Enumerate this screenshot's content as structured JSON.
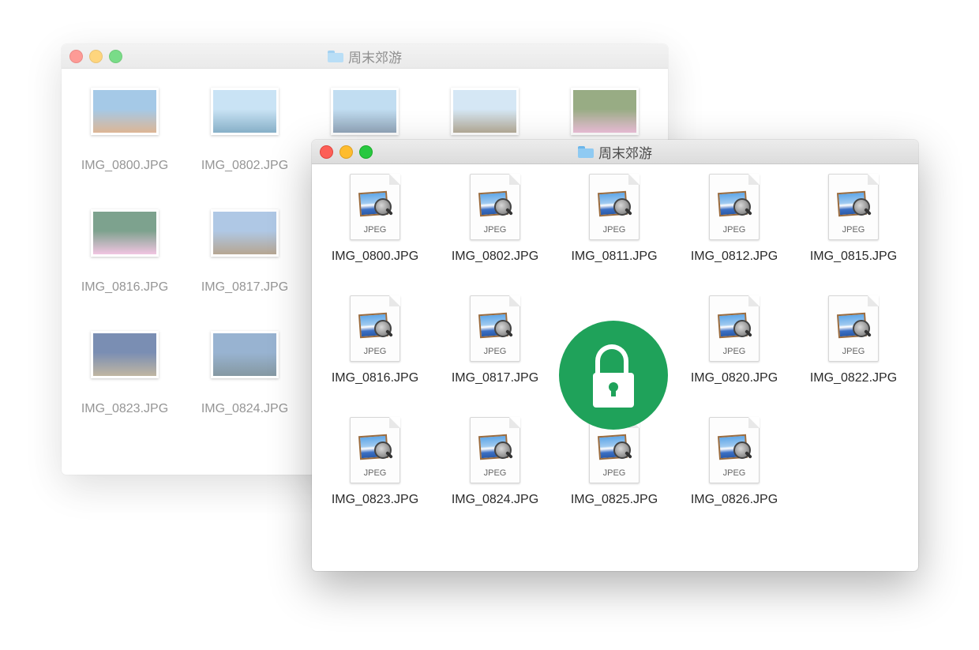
{
  "back_window": {
    "title": "周末郊游",
    "files": [
      {
        "name": "IMG_0800.JPG",
        "colors": [
          "#6fa9d9",
          "#c98a55"
        ]
      },
      {
        "name": "IMG_0802.JPG",
        "colors": [
          "#a9d3ef",
          "#3e7fa6"
        ]
      },
      {
        "name": "IMG_0811.JPG",
        "colors": [
          "#9cc9e9",
          "#4f6f8f"
        ]
      },
      {
        "name": "IMG_0812.JPG",
        "colors": [
          "#bcd9f0",
          "#8a7a5a"
        ]
      },
      {
        "name": "IMG_0815.JPG",
        "colors": [
          "#5a7a3a",
          "#e59bc4"
        ]
      },
      {
        "name": "IMG_0816.JPG",
        "colors": [
          "#2f6a4a",
          "#e9a2d0"
        ]
      },
      {
        "name": "IMG_0817.JPG",
        "colors": [
          "#7fa7d6",
          "#8a7050"
        ]
      },
      {
        "name": "IMG_0823.JPG",
        "colors": [
          "#2a4a86",
          "#9a8a6a"
        ]
      },
      {
        "name": "IMG_0824.JPG",
        "colors": [
          "#5a86b6",
          "#3c5a6a"
        ]
      }
    ]
  },
  "front_window": {
    "title": "周末郊游",
    "file_type_label": "JPEG",
    "files": [
      "IMG_0800.JPG",
      "IMG_0802.JPG",
      "IMG_0811.JPG",
      "IMG_0812.JPG",
      "IMG_0815.JPG",
      "IMG_0816.JPG",
      "IMG_0817.JPG",
      "IMG_0820.JPG",
      "IMG_0822.JPG",
      "IMG_0823.JPG",
      "IMG_0824.JPG",
      "IMG_0825.JPG",
      "IMG_0826.JPG"
    ]
  },
  "overlay": {
    "icon": "lock-icon",
    "color": "#1fa25a"
  }
}
